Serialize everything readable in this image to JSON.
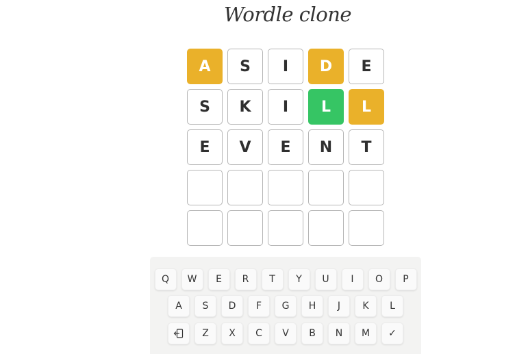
{
  "title": "Wordle clone",
  "board": {
    "rows": [
      [
        {
          "letter": "A",
          "state": "present"
        },
        {
          "letter": "S",
          "state": "empty"
        },
        {
          "letter": "I",
          "state": "empty"
        },
        {
          "letter": "D",
          "state": "present"
        },
        {
          "letter": "E",
          "state": "empty"
        }
      ],
      [
        {
          "letter": "S",
          "state": "empty"
        },
        {
          "letter": "K",
          "state": "empty"
        },
        {
          "letter": "I",
          "state": "empty"
        },
        {
          "letter": "L",
          "state": "correct"
        },
        {
          "letter": "L",
          "state": "present"
        }
      ],
      [
        {
          "letter": "E",
          "state": "empty"
        },
        {
          "letter": "V",
          "state": "empty"
        },
        {
          "letter": "E",
          "state": "empty"
        },
        {
          "letter": "N",
          "state": "empty"
        },
        {
          "letter": "T",
          "state": "empty"
        }
      ],
      [
        {
          "letter": "",
          "state": "empty"
        },
        {
          "letter": "",
          "state": "empty"
        },
        {
          "letter": "",
          "state": "empty"
        },
        {
          "letter": "",
          "state": "empty"
        },
        {
          "letter": "",
          "state": "empty"
        }
      ],
      [
        {
          "letter": "",
          "state": "empty"
        },
        {
          "letter": "",
          "state": "empty"
        },
        {
          "letter": "",
          "state": "empty"
        },
        {
          "letter": "",
          "state": "empty"
        },
        {
          "letter": "",
          "state": "empty"
        }
      ]
    ]
  },
  "keyboard": {
    "row1": [
      "Q",
      "W",
      "E",
      "R",
      "T",
      "Y",
      "U",
      "I",
      "O",
      "P"
    ],
    "row2": [
      "A",
      "S",
      "D",
      "F",
      "G",
      "H",
      "J",
      "K",
      "L"
    ],
    "row3": [
      "Z",
      "X",
      "C",
      "V",
      "B",
      "N",
      "M"
    ],
    "backspace_icon": "backspace-icon",
    "enter_label": "✓"
  },
  "colors": {
    "present": "#eab12a",
    "correct": "#36c564",
    "empty_border": "#b5b5b5",
    "text": "#2f2f2f"
  }
}
